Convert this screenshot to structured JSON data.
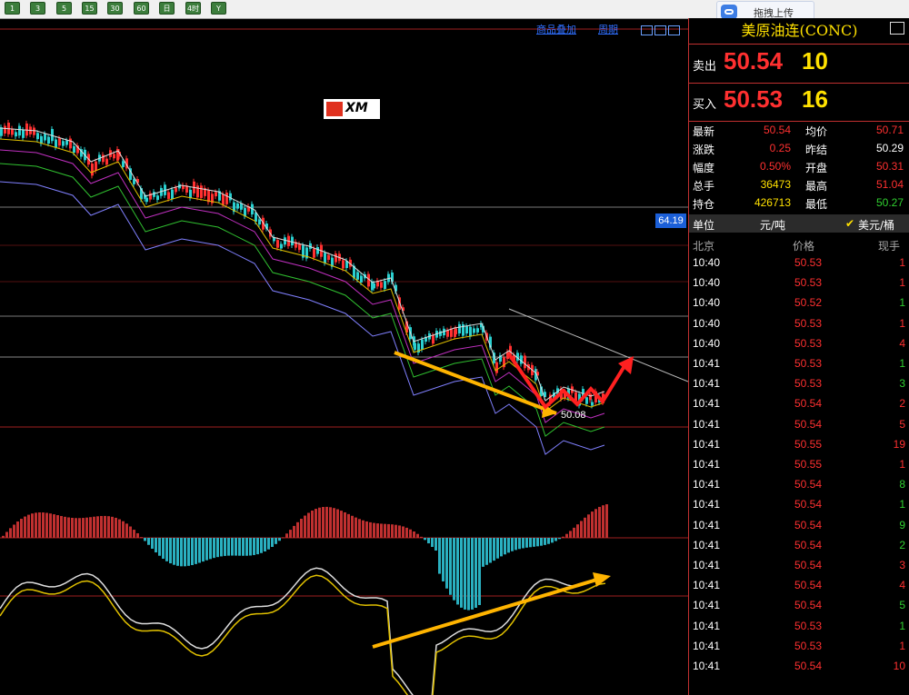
{
  "toolbar": {
    "buttons": [
      "1",
      "3",
      "5",
      "15",
      "30",
      "60",
      "日",
      "4时",
      "Y"
    ]
  },
  "upload_button": {
    "label": "拖拽上传"
  },
  "chart": {
    "links": [
      "商品叠加",
      "周期"
    ],
    "price_tag": "64.19",
    "low_label": "50.08",
    "logo_text": "XM",
    "colors": {
      "up": "#ff3030",
      "down": "#2ad0d0",
      "ma1": "#ffffff",
      "ma2": "#e0c000",
      "ma3": "#c030c0",
      "ma4": "#30c030",
      "ma5": "#8080ff",
      "arrow_red": "#ff2020",
      "arrow_orange": "#ffb400"
    }
  },
  "panel": {
    "title": "美原油连(CONC)",
    "sell_label": "卖出",
    "sell_price": "50.54",
    "sell_vol": "10",
    "buy_label": "买入",
    "buy_price": "50.53",
    "buy_vol": "16",
    "stats": [
      {
        "l1": "最新",
        "v1": "50.54",
        "c1": "#ff3030",
        "l2": "均价",
        "v2": "50.71",
        "c2": "#ff3030"
      },
      {
        "l1": "涨跌",
        "v1": "0.25",
        "c1": "#ff3030",
        "l2": "昨结",
        "v2": "50.29",
        "c2": "#ffffff"
      },
      {
        "l1": "幅度",
        "v1": "0.50%",
        "c1": "#ff3030",
        "l2": "开盘",
        "v2": "50.31",
        "c2": "#ff3030"
      },
      {
        "l1": "总手",
        "v1": "36473",
        "c1": "#ffe100",
        "l2": "最高",
        "v2": "51.04",
        "c2": "#ff3030"
      },
      {
        "l1": "持仓",
        "v1": "426713",
        "c1": "#ffe100",
        "l2": "最低",
        "v2": "50.27",
        "c2": "#30d030"
      }
    ],
    "unit_label": "单位",
    "unit_opt1": "元/吨",
    "unit_opt2": "美元/桶",
    "ticks_header": {
      "time": "北京",
      "price": "价格",
      "vol": "现手"
    },
    "ticks": [
      {
        "time": "10:40",
        "price": "50.53",
        "vol": "1",
        "vc": "#ff3030"
      },
      {
        "time": "10:40",
        "price": "50.53",
        "vol": "1",
        "vc": "#ff3030"
      },
      {
        "time": "10:40",
        "price": "50.52",
        "vol": "1",
        "vc": "#30d030"
      },
      {
        "time": "10:40",
        "price": "50.53",
        "vol": "1",
        "vc": "#ff3030"
      },
      {
        "time": "10:40",
        "price": "50.53",
        "vol": "4",
        "vc": "#ff3030"
      },
      {
        "time": "10:41",
        "price": "50.53",
        "vol": "1",
        "vc": "#30d030"
      },
      {
        "time": "10:41",
        "price": "50.53",
        "vol": "3",
        "vc": "#30d030"
      },
      {
        "time": "10:41",
        "price": "50.54",
        "vol": "2",
        "vc": "#ff3030"
      },
      {
        "time": "10:41",
        "price": "50.54",
        "vol": "5",
        "vc": "#ff3030"
      },
      {
        "time": "10:41",
        "price": "50.55",
        "vol": "19",
        "vc": "#ff3030"
      },
      {
        "time": "10:41",
        "price": "50.55",
        "vol": "1",
        "vc": "#ff3030"
      },
      {
        "time": "10:41",
        "price": "50.54",
        "vol": "8",
        "vc": "#30d030"
      },
      {
        "time": "10:41",
        "price": "50.54",
        "vol": "1",
        "vc": "#30d030"
      },
      {
        "time": "10:41",
        "price": "50.54",
        "vol": "9",
        "vc": "#30d030"
      },
      {
        "time": "10:41",
        "price": "50.54",
        "vol": "2",
        "vc": "#30d030"
      },
      {
        "time": "10:41",
        "price": "50.54",
        "vol": "3",
        "vc": "#ff3030"
      },
      {
        "time": "10:41",
        "price": "50.54",
        "vol": "4",
        "vc": "#ff3030"
      },
      {
        "time": "10:41",
        "price": "50.54",
        "vol": "5",
        "vc": "#30d030"
      },
      {
        "time": "10:41",
        "price": "50.53",
        "vol": "1",
        "vc": "#30d030"
      },
      {
        "time": "10:41",
        "price": "50.53",
        "vol": "1",
        "vc": "#ff3030"
      },
      {
        "time": "10:41",
        "price": "50.54",
        "vol": "10",
        "vc": "#ff3030"
      }
    ]
  }
}
